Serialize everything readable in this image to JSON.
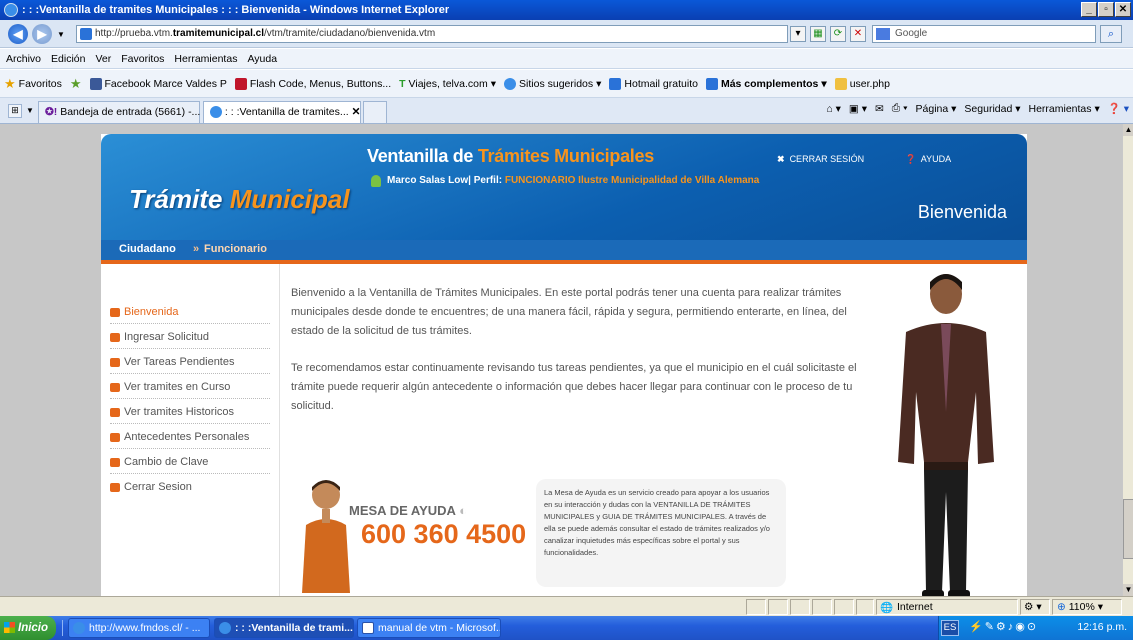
{
  "window": {
    "title": ": : :Ventanilla de tramites Municipales : : : Bienvenida - Windows Internet Explorer"
  },
  "address": {
    "url_prefix": "http://prueba.vtm.",
    "url_domain": "tramitemunicipal.cl",
    "url_path": "/vtm/tramite/ciudadano/bienvenida.vtm"
  },
  "search": {
    "placeholder": "Google"
  },
  "menu": [
    "Archivo",
    "Edición",
    "Ver",
    "Favoritos",
    "Herramientas",
    "Ayuda"
  ],
  "favorites": {
    "label": "Favoritos",
    "items": [
      "Facebook Marce Valdes P",
      "Flash Code, Menus, Buttons...",
      "Viajes, telva.com",
      "Sitios sugeridos",
      "Hotmail gratuito",
      "Más complementos",
      "user.php"
    ]
  },
  "tabs": [
    "Bandeja de entrada (5661) -...",
    ": : :Ventanilla de tramites..."
  ],
  "commands": [
    "Página",
    "Seguridad",
    "Herramientas"
  ],
  "site": {
    "logo_a": "Trámite",
    "logo_b": "Municipal",
    "title_a": "Ventanilla de",
    "title_b": "Trámites Municipales",
    "user_name": "Marco Salas Low| Perfil:",
    "user_profile": "FUNCIONARIO Ilustre Municipalidad de Villa Alemana",
    "logout": "CERRAR SESIÓN",
    "help": "AYUDA",
    "welcome": "Bienvenida",
    "subnav": [
      "Ciudadano",
      "Funcionario"
    ],
    "sidebar": [
      "Bienvenida",
      "Ingresar Solicitud",
      "Ver Tareas Pendientes",
      "Ver tramites en Curso",
      "Ver tramites Historicos",
      "Antecedentes Personales",
      "Cambio de Clave",
      "Cerrar Sesion"
    ],
    "paragraph1": "Bienvenido a la Ventanilla de Trámites Municipales. En este portal podrás tener una cuenta para realizar trámites municipales desde donde te encuentres; de una manera fácil, rápida y segura, permitiendo enterarte, en línea, del estado de la solicitud de tus trámites.",
    "paragraph2": "Te recomendamos estar continuamente revisando tus tareas pendientes, ya que el municipio en el cuál solicitaste el trámite puede requerir algún antecedente o información que debes hacer llegar para continuar con le proceso de tu solicitud.",
    "helpdesk_label": "MESA DE AYUDA",
    "helpdesk_phone": "600 360 4500",
    "helpdesk_text": "La Mesa de Ayuda es un servicio creado para apoyar a los usuarios en su interacción y dudas con la VENTANILLA DE TRÁMITES MUNICIPALES y GUIA DE TRÁMITES MUNICIPALES. A través de ella se puede además consultar el estado de trámites realizados y/o canalizar inquietudes más específicas sobre el portal y sus funcionalidades."
  },
  "status": {
    "zone": "Internet",
    "zoom": "110%"
  },
  "taskbar": {
    "start": "Inicio",
    "tasks": [
      "http://www.fmdos.cl/ - ...",
      ": : :Ventanilla de trami...",
      "manual de vtm - Microsof..."
    ],
    "lang": "ES",
    "clock": "12:16 p.m."
  },
  "colors": {
    "accent_orange": "#e5671a",
    "banner_blue": "#0c5fb0",
    "taskbar_blue": "#245edb"
  }
}
